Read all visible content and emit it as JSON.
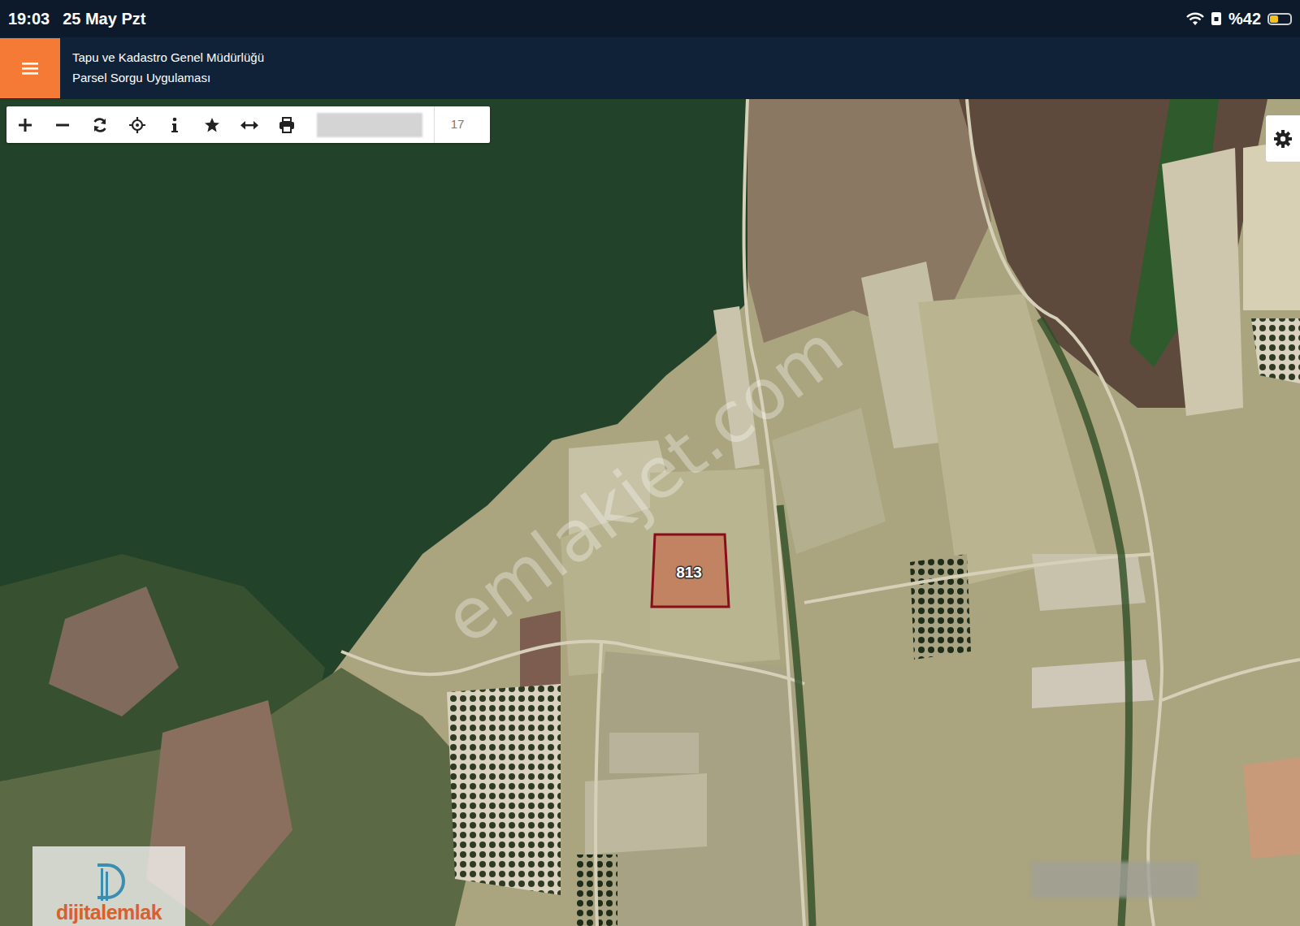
{
  "status_bar": {
    "time": "19:03",
    "date": "25 May Pzt",
    "battery": "%42",
    "battery_level": 0.42
  },
  "app_bar": {
    "title": "Tapu ve Kadastro Genel Müdürlüğü",
    "subtitle": "Parsel Sorgu Uygulaması"
  },
  "toolbar": {
    "zoom": "17"
  },
  "map": {
    "parcels": [
      {
        "label": "813",
        "selected": true
      }
    ],
    "watermark": "emlakjet.com",
    "logo": "dijitalemlak"
  }
}
